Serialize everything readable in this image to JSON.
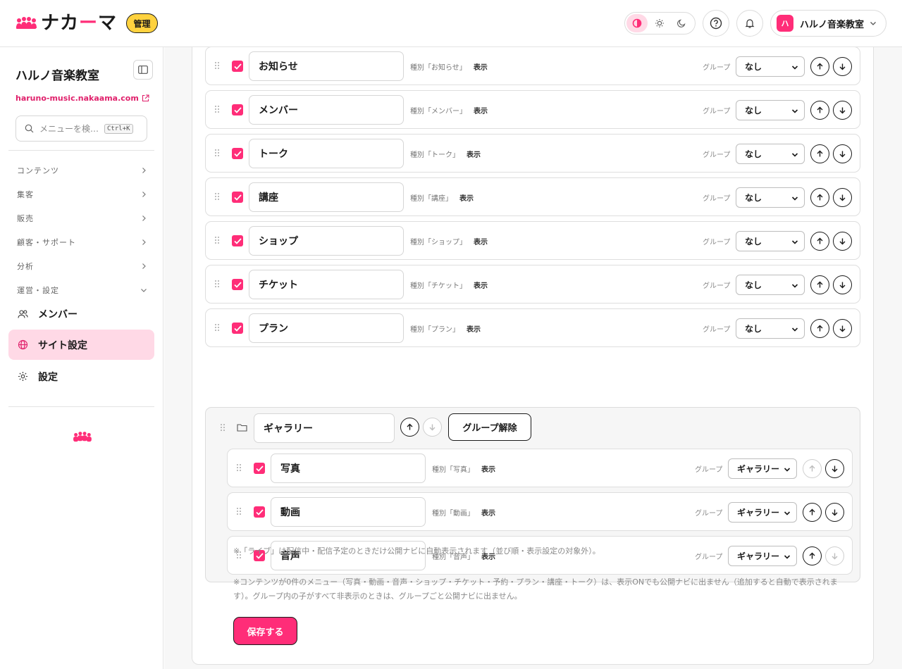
{
  "header": {
    "logo_text_1": "ナカ",
    "logo_text_dash": "ー",
    "logo_text_2": "マ",
    "admin_badge": "管理",
    "site_avatar": "ハ",
    "site_name": "ハルノ音楽教室",
    "theme_modes": [
      "contrast-icon",
      "sun-icon",
      "moon-icon"
    ],
    "active_theme": "contrast"
  },
  "sidebar": {
    "title": "ハルノ音楽教室",
    "url": "haruno-music.nakaama.com",
    "search_placeholder": "メニューを検…",
    "search_shortcut": "Ctrl+K",
    "categories": [
      {
        "label": "コンテンツ",
        "expanded": false
      },
      {
        "label": "集客",
        "expanded": false
      },
      {
        "label": "販売",
        "expanded": false
      },
      {
        "label": "顧客・サポート",
        "expanded": false
      },
      {
        "label": "分析",
        "expanded": false
      },
      {
        "label": "運営・設定",
        "expanded": true
      }
    ],
    "items": [
      {
        "label": "メンバー",
        "icon": "users-icon",
        "active": false
      },
      {
        "label": "サイト設定",
        "icon": "globe-icon",
        "active": true
      },
      {
        "label": "設定",
        "icon": "gear-icon",
        "active": false
      }
    ]
  },
  "menu_rows": [
    {
      "name": "お知らせ",
      "kind": "種別「お知らせ」",
      "visibility": "表示",
      "group_label": "グループ",
      "group": "なし",
      "checked": true
    },
    {
      "name": "メンバー",
      "kind": "種別「メンバー」",
      "visibility": "表示",
      "group_label": "グループ",
      "group": "なし",
      "checked": true
    },
    {
      "name": "トーク",
      "kind": "種別「トーク」",
      "visibility": "表示",
      "group_label": "グループ",
      "group": "なし",
      "checked": true
    },
    {
      "name": "講座",
      "kind": "種別「講座」",
      "visibility": "表示",
      "group_label": "グループ",
      "group": "なし",
      "checked": true
    },
    {
      "name": "ショップ",
      "kind": "種別「ショップ」",
      "visibility": "表示",
      "group_label": "グループ",
      "group": "なし",
      "checked": true
    },
    {
      "name": "チケット",
      "kind": "種別「チケット」",
      "visibility": "表示",
      "group_label": "グループ",
      "group": "なし",
      "checked": true
    },
    {
      "name": "プラン",
      "kind": "種別「プラン」",
      "visibility": "表示",
      "group_label": "グループ",
      "group": "なし",
      "checked": true
    }
  ],
  "group": {
    "name": "ギャラリー",
    "ungroup_label": "グループ解除",
    "children": [
      {
        "name": "写真",
        "kind": "種別「写真」",
        "visibility": "表示",
        "group_label": "グループ",
        "group": "ギャラリー",
        "checked": true,
        "up_disabled": true,
        "down_disabled": false
      },
      {
        "name": "動画",
        "kind": "種別「動画」",
        "visibility": "表示",
        "group_label": "グループ",
        "group": "ギャラリー",
        "checked": true,
        "up_disabled": false,
        "down_disabled": false
      },
      {
        "name": "音声",
        "kind": "種別「音声」",
        "visibility": "表示",
        "group_label": "グループ",
        "group": "ギャラリー",
        "checked": true,
        "up_disabled": false,
        "down_disabled": true
      }
    ]
  },
  "notes": {
    "live": "※「ライブ」は配信中・配信予定のときだけ公開ナビに自動表示されます（並び順・表示設定の対象外）。",
    "empty_1": "※コンテンツが0件のメニュー（写真・動画・音声・ショップ・チケット・予約・プラン・講座・トーク）は、表示ONでも公開ナビに出ません（追加すると自動で表示されま",
    "empty_2": "す）。グループ内の子がすべて非表示のときは、グループごと公開ナビに出ません。"
  },
  "save_label": "保存する",
  "colors": {
    "accent": "#ff2d78",
    "accent_soft": "#ffd9e6",
    "badge": "#ffd23f"
  }
}
